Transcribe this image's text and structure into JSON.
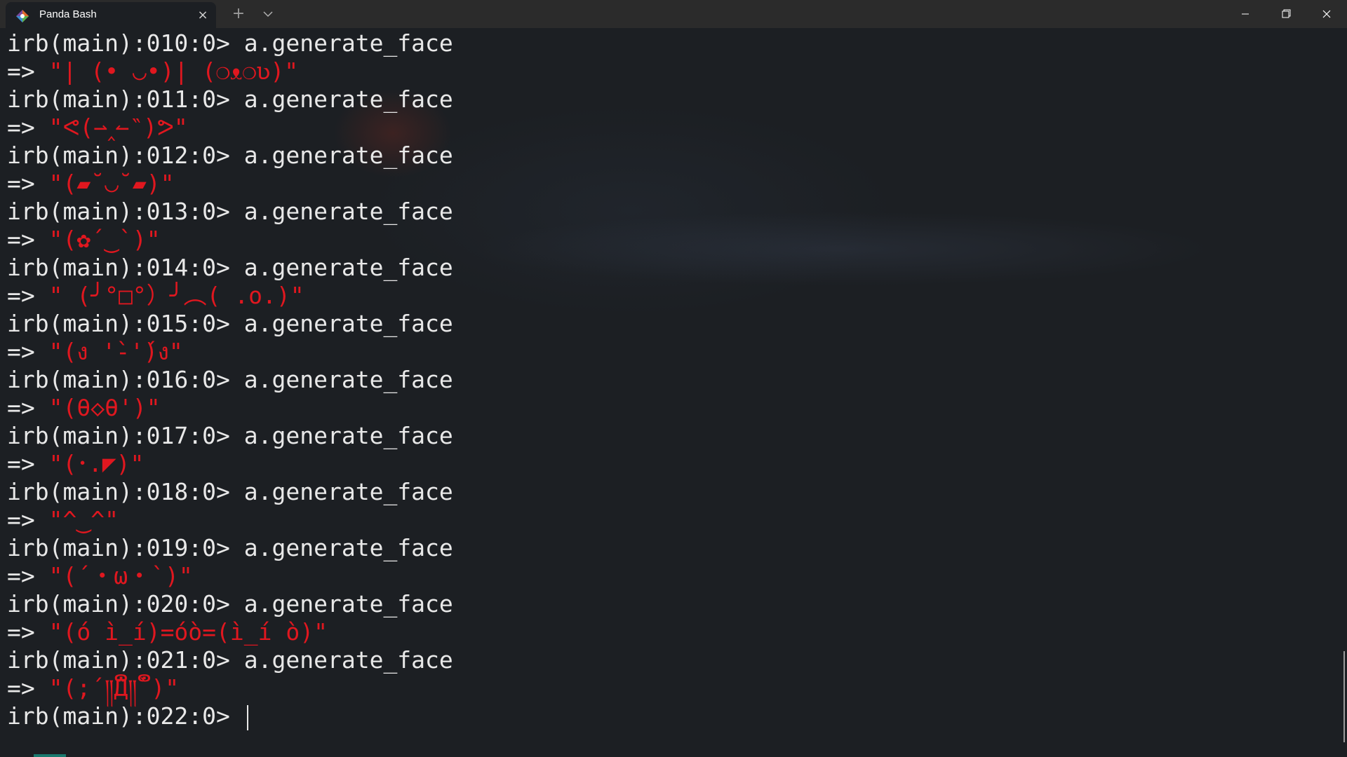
{
  "window": {
    "tab_title": "Panda Bash",
    "icons": {
      "tab": "git-bash-diamond-icon",
      "close": "close-icon",
      "new_tab": "plus-icon",
      "dropdown": "chevron-down-icon",
      "minimize": "minimize-icon",
      "maximize": "restore-icon",
      "window_close": "window-close-icon"
    },
    "new_tab_glyph": "+",
    "close_glyph": "×"
  },
  "colors": {
    "background": "#1c1f23",
    "titlebar": "#2b2b2b",
    "text": "#e8e8e8",
    "result": "#e0171f",
    "accent": "#1a7a6e"
  },
  "terminal": {
    "arrow": "=>",
    "entries": [
      {
        "prompt": "irb(main):010:0> ",
        "command": "a.generate_face",
        "result": "\"| (• ◡•)| (❍ᴥ❍ʋ)\""
      },
      {
        "prompt": "irb(main):011:0> ",
        "command": "a.generate_face",
        "result": "\"ᕙ(⇀‸↼‶)ᕗ\""
      },
      {
        "prompt": "irb(main):012:0> ",
        "command": "a.generate_face",
        "result": "\"(▰˘◡˘▰)\""
      },
      {
        "prompt": "irb(main):013:0> ",
        "command": "a.generate_face",
        "result": "\"(✿´‿`)\""
      },
      {
        "prompt": "irb(main):014:0> ",
        "command": "a.generate_face",
        "result": "\" (╯°□°）╯︵( .o.)\""
      },
      {
        "prompt": "irb(main):015:0> ",
        "command": "a.generate_face",
        "result": "\"(ง '̀-'́)ง\""
      },
      {
        "prompt": "irb(main):016:0> ",
        "command": "a.generate_face",
        "result": "\"(θ◇θ')\""
      },
      {
        "prompt": "irb(main):017:0> ",
        "command": "a.generate_face",
        "result": "\"(･.◤)\""
      },
      {
        "prompt": "irb(main):018:0> ",
        "command": "a.generate_face",
        "result": "\"^‿^\""
      },
      {
        "prompt": "irb(main):019:0> ",
        "command": "a.generate_face",
        "result": "\"(´・ω・`)\""
      },
      {
        "prompt": "irb(main):020:0> ",
        "command": "a.generate_face",
        "result": "\"(ó ì_í)=óò=(ì_í ò)\""
      },
      {
        "prompt": "irb(main):021:0> ",
        "command": "a.generate_face",
        "result": "\"(;´༎ຶД༎ຶ`)\""
      }
    ],
    "current_prompt": "irb(main):022:0> "
  }
}
